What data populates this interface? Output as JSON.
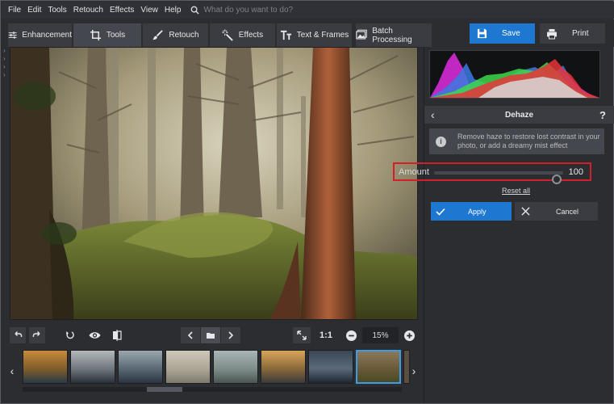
{
  "menu": {
    "items": [
      "File",
      "Edit",
      "Tools",
      "Retouch",
      "Effects",
      "View",
      "Help"
    ],
    "search_placeholder": "What do you want to do?"
  },
  "toolbar": {
    "tabs": [
      {
        "label": "Enhancement",
        "icon": "sliders-icon"
      },
      {
        "label": "Tools",
        "icon": "crop-icon",
        "active": true
      },
      {
        "label": "Retouch",
        "icon": "brush-icon"
      },
      {
        "label": "Effects",
        "icon": "sparkle-wand-icon"
      },
      {
        "label": "Text & Frames",
        "icon": "text-icon"
      },
      {
        "label": "Batch Processing",
        "icon": "images-icon"
      }
    ],
    "save_label": "Save",
    "print_label": "Print"
  },
  "controls": {
    "actual_size_label": "1:1",
    "zoom_value": "15%"
  },
  "panel": {
    "title": "Dehaze",
    "help": "?",
    "info_text": "Remove haze to restore lost contrast in your photo, or add a dreamy mist effect",
    "amount_label": "Amount",
    "amount_value": "100",
    "amount_fraction": 0.95,
    "reset_label": "Reset all",
    "apply_label": "Apply",
    "cancel_label": "Cancel"
  },
  "colors": {
    "accent": "#1e78d2",
    "highlight_border": "#d21f2a",
    "selected_thumb": "#3d9be9"
  }
}
